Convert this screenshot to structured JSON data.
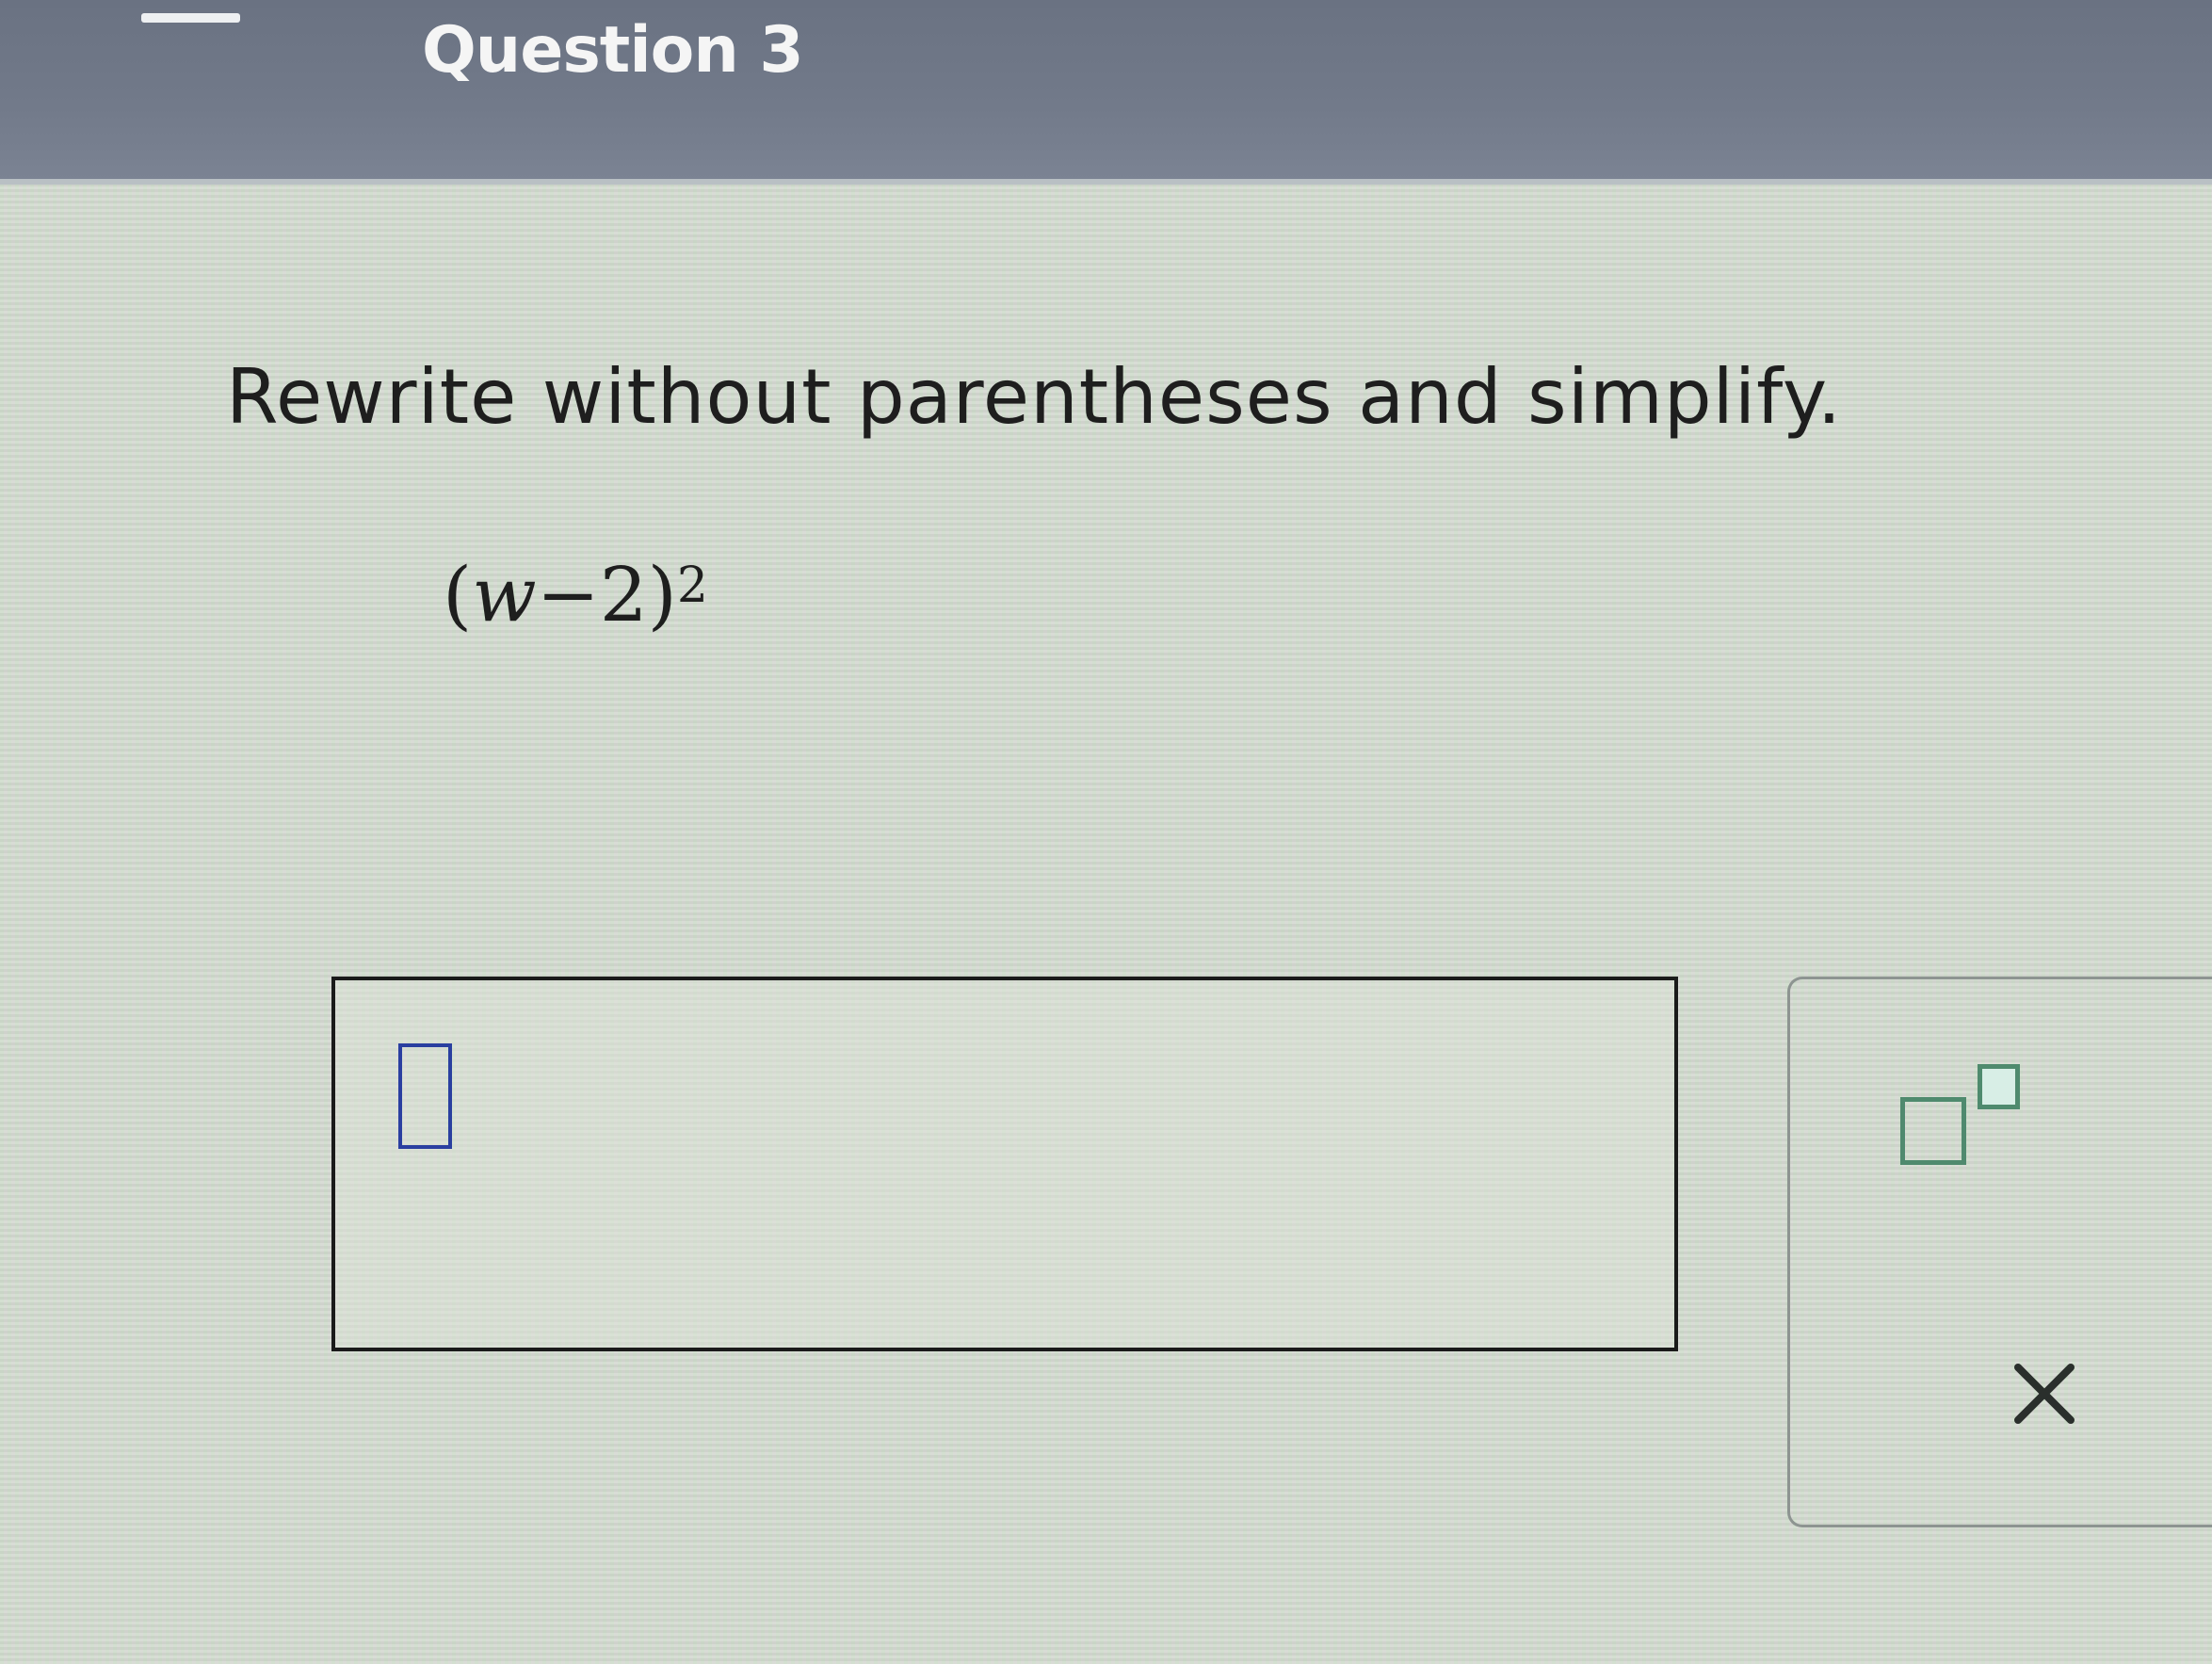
{
  "header": {
    "title": "Question 3"
  },
  "question": {
    "instruction": "Rewrite without parentheses and simplify.",
    "expression": {
      "open_paren": "(",
      "variable": "w",
      "operator": "−",
      "constant": "2",
      "close_paren": ")",
      "exponent": "2"
    }
  },
  "answer": {
    "value": ""
  },
  "toolbox": {
    "buttons": [
      {
        "icon": "exponent-icon"
      },
      {
        "icon": "close-icon"
      }
    ]
  },
  "colors": {
    "header_bg": "#727a8a",
    "content_bg": "#d3dccf",
    "cursor_border": "#2a3fa0",
    "tool_accent": "#4f8a6e"
  }
}
